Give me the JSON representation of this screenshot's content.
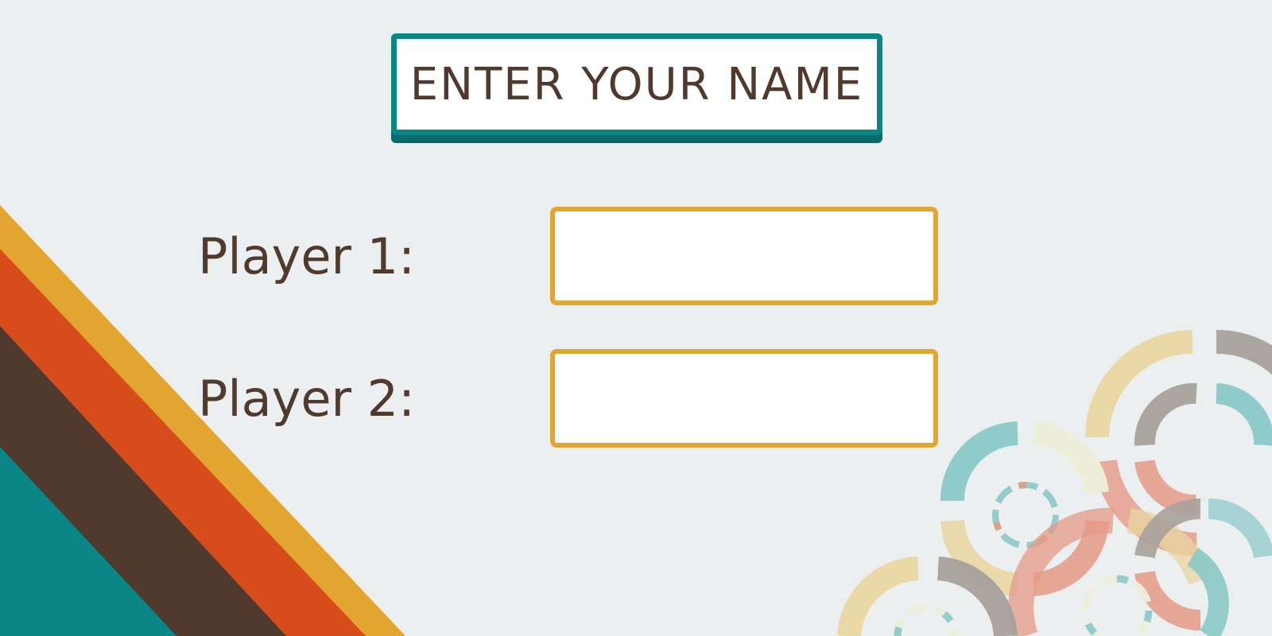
{
  "screen": {
    "title": "ENTER YOUR NAME"
  },
  "players": [
    {
      "label": "Player 1:",
      "value": "",
      "placeholder": ""
    },
    {
      "label": "Player 2:",
      "value": "",
      "placeholder": ""
    }
  ],
  "colors": {
    "background": "#ebeff0",
    "teal": "#0b8687",
    "brown": "#4f3a2d",
    "orange": "#d64c1b",
    "yellow": "#e2a630",
    "salmon": "#e59a87",
    "sand": "#ead6a2",
    "gray": "#a8a19b",
    "light_teal": "#8ac8c7",
    "cream": "#eeeed9"
  },
  "decorations": {
    "bottom_left": "diagonal-stripes",
    "bottom_right": "circle-rings-pattern"
  }
}
